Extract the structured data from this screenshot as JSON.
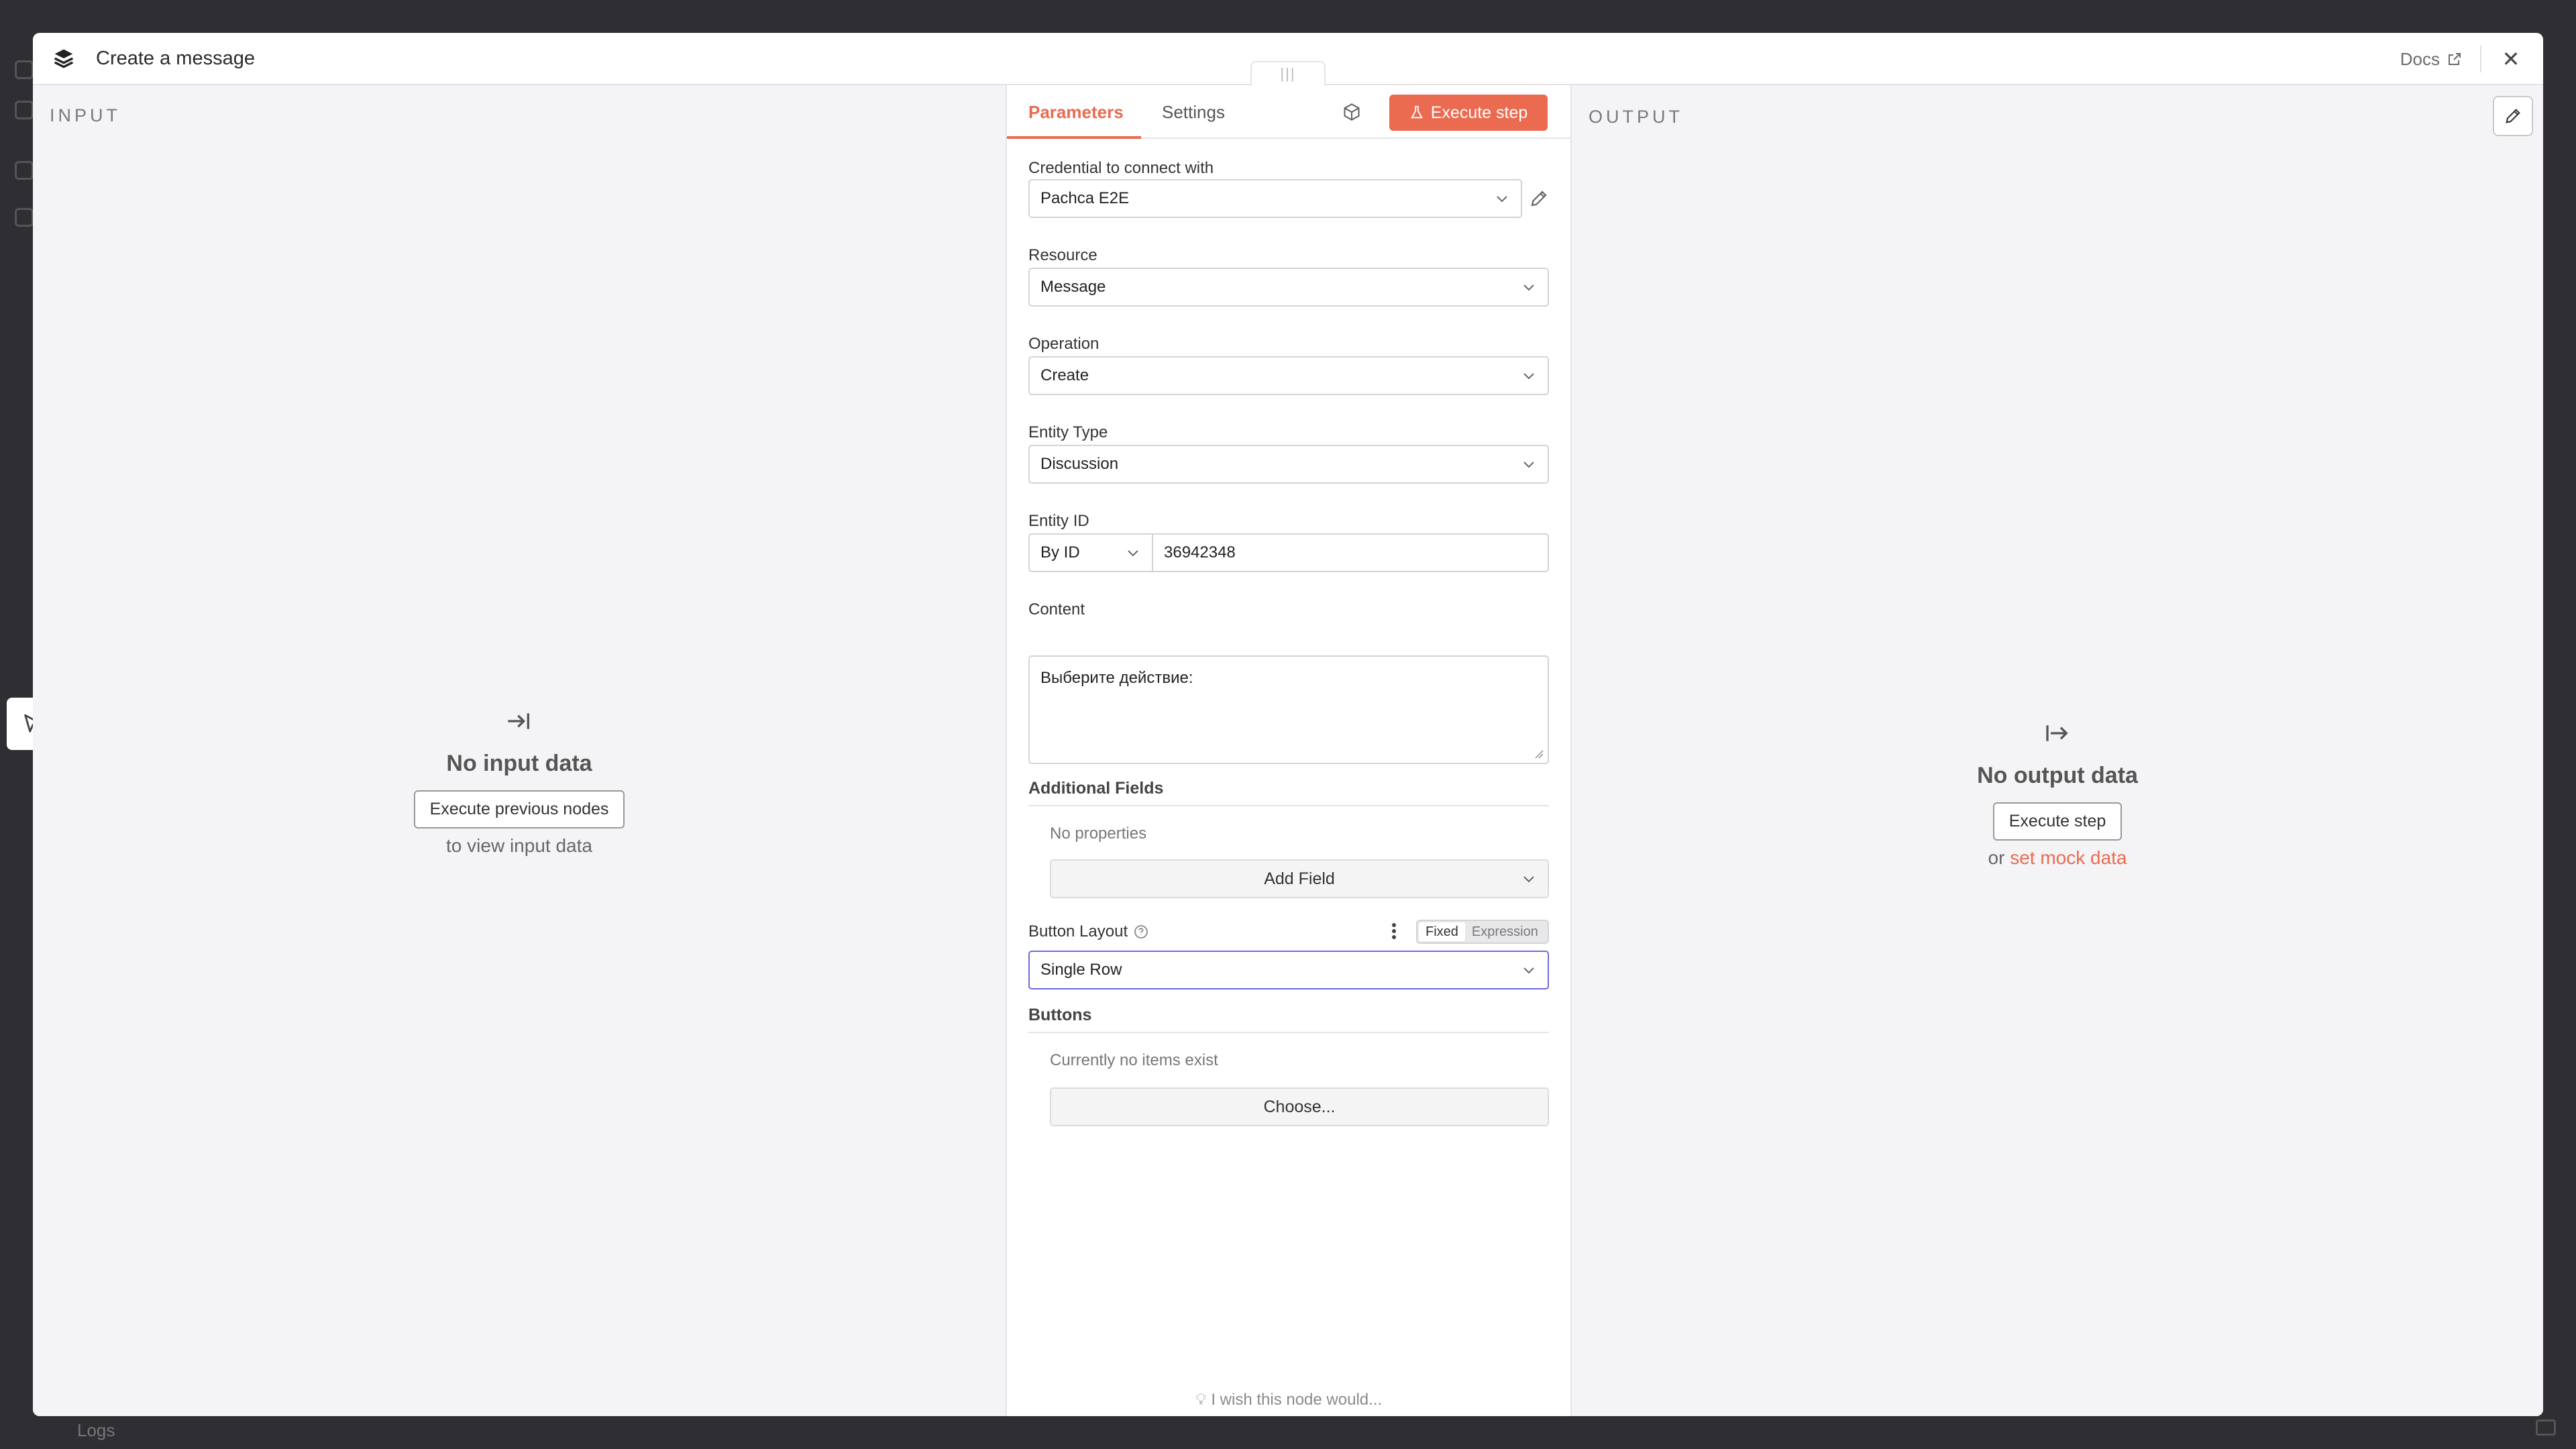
{
  "background": {
    "logs_label": "Logs"
  },
  "modal": {
    "title": "Create a message",
    "docs_label": "Docs"
  },
  "input_pane": {
    "label": "INPUT",
    "empty_title": "No input data",
    "button_label": "Execute previous nodes",
    "sub_text": "to view input data"
  },
  "output_pane": {
    "label": "OUTPUT",
    "empty_title": "No output data",
    "button_label": "Execute step",
    "or_text": "or",
    "mock_link": "set mock data"
  },
  "center": {
    "tabs": [
      {
        "label": "Parameters",
        "active": true
      },
      {
        "label": "Settings",
        "active": false
      }
    ],
    "execute_label": "Execute step",
    "fields": {
      "credential": {
        "label": "Credential to connect with",
        "value": "Pachca E2E"
      },
      "resource": {
        "label": "Resource",
        "value": "Message"
      },
      "operation": {
        "label": "Operation",
        "value": "Create"
      },
      "entity_type": {
        "label": "Entity Type",
        "value": "Discussion"
      },
      "entity_id": {
        "label": "Entity ID",
        "mode": "By ID",
        "value": "36942348"
      },
      "content": {
        "label": "Content",
        "value": "Выберите действие:"
      }
    },
    "additional_fields": {
      "title": "Additional Fields",
      "empty_text": "No properties",
      "add_label": "Add Field"
    },
    "button_layout": {
      "label": "Button Layout",
      "toggle_fixed": "Fixed",
      "toggle_expression": "Expression",
      "value": "Single Row"
    },
    "buttons": {
      "title": "Buttons",
      "empty_text": "Currently no items exist",
      "choose_label": "Choose..."
    },
    "wish_text": "I wish this node would..."
  },
  "colors": {
    "accent": "#ea6b4f",
    "focus": "#6b6bdf",
    "pane_bg": "#f4f4f6"
  }
}
